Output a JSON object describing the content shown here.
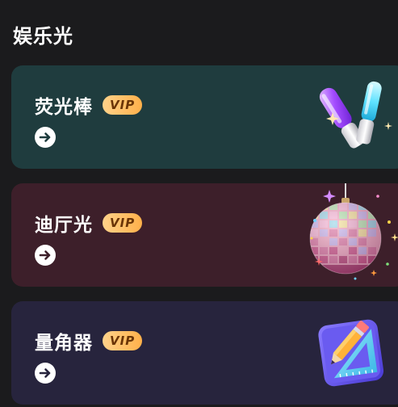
{
  "section": {
    "title": "娱乐光"
  },
  "cards": [
    {
      "title": "荧光棒",
      "badge": "VIP",
      "icon": "glow-stick-icon",
      "background": "#1f3c3e"
    },
    {
      "title": "迪厅光",
      "badge": "VIP",
      "icon": "disco-ball-icon",
      "background": "#3d1f2a"
    },
    {
      "title": "量角器",
      "badge": "VIP",
      "icon": "protractor-ruler-icon",
      "background": "#27243d"
    }
  ],
  "colors": {
    "page_background": "#1b1b1d",
    "vip_gradient_start": "#ffd28a",
    "vip_gradient_end": "#ffb04a",
    "vip_text": "#6a3406"
  }
}
